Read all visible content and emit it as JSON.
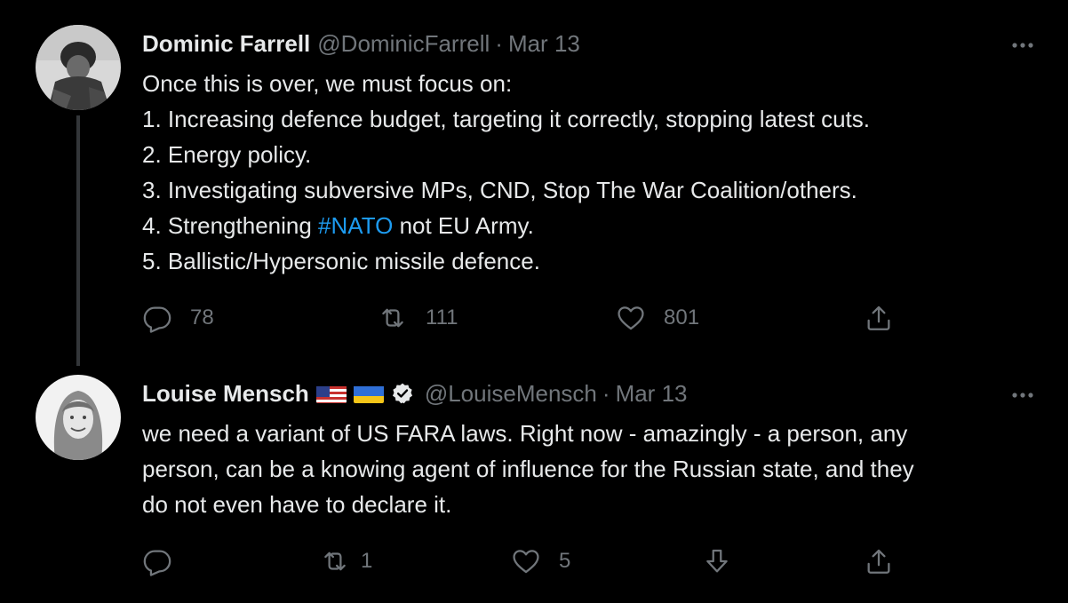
{
  "tweets": [
    {
      "author_name": "Dominic Farrell",
      "handle": "@DominicFarrell",
      "separator": "·",
      "date": "Mar 13",
      "body_lines": [
        "Once this is over, we must focus on:",
        "1. Increasing defence budget, targeting it correctly, stopping latest cuts.",
        "2. Energy policy.",
        "3. Investigating subversive MPs, CND, Stop The War Coalition/others."
      ],
      "line5_prefix": "4. Strengthening ",
      "line5_hashtag": "#NATO",
      "line5_suffix": " not EU Army.",
      "line6": "5. Ballistic/Hypersonic missile defence.",
      "reply_count": "78",
      "retweet_count": "111",
      "like_count": "801",
      "icons": [
        "avatar",
        "more-icon",
        "reply-icon",
        "retweet-icon",
        "like-icon",
        "share-icon"
      ]
    },
    {
      "author_name": "Louise Mensch",
      "handle": "@LouiseMensch",
      "separator": "·",
      "date": "Mar 13",
      "body_lines": [
        "we need a variant of US FARA laws. Right now - amazingly - a person, any",
        "person, can be a knowing agent of influence for the Russian state, and they",
        "do not even have to declare it."
      ],
      "reply_count": "",
      "retweet_count": "1",
      "like_count": "5",
      "icons": [
        "avatar",
        "us-flag-icon",
        "ukraine-flag-icon",
        "verified-icon",
        "more-icon",
        "reply-icon",
        "retweet-icon",
        "like-icon",
        "downvote-icon",
        "share-icon"
      ]
    }
  ],
  "colors": {
    "background": "#000000",
    "text": "#e7e9ea",
    "secondary": "#71767b",
    "link": "#1d9bf0",
    "thread_line": "#333639"
  }
}
